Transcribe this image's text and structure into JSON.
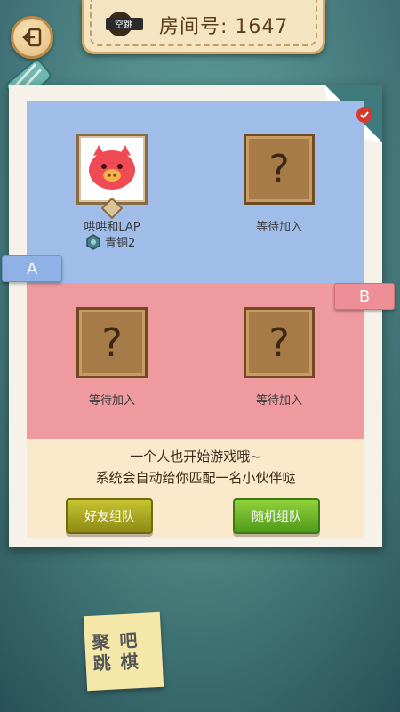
{
  "header": {
    "logo_text": "空跳",
    "room_label": "房间号: 1647"
  },
  "teams": {
    "a_label": "A",
    "b_label": "B"
  },
  "slots": [
    {
      "player": "哄哄和LAP",
      "rank": "青铜2",
      "occupied": true
    },
    {
      "player": "等待加入",
      "occupied": false
    },
    {
      "player": "等待加入",
      "occupied": false
    },
    {
      "player": "等待加入",
      "occupied": false
    }
  ],
  "question_mark": "?",
  "info": {
    "line1": "一个人也开始游戏哦~",
    "line2": "系统会自动给你匹配一名小伙伴哒"
  },
  "buttons": {
    "friend": "好友组队",
    "random": "随机组队"
  },
  "sticky_note": {
    "line1": "聚 吧",
    "line2": "跳 棋"
  },
  "colors": {
    "team_a": "#9fbde8",
    "team_b": "#ef9a9e",
    "friend_btn": "#a8a522",
    "random_btn": "#6fb62a"
  }
}
